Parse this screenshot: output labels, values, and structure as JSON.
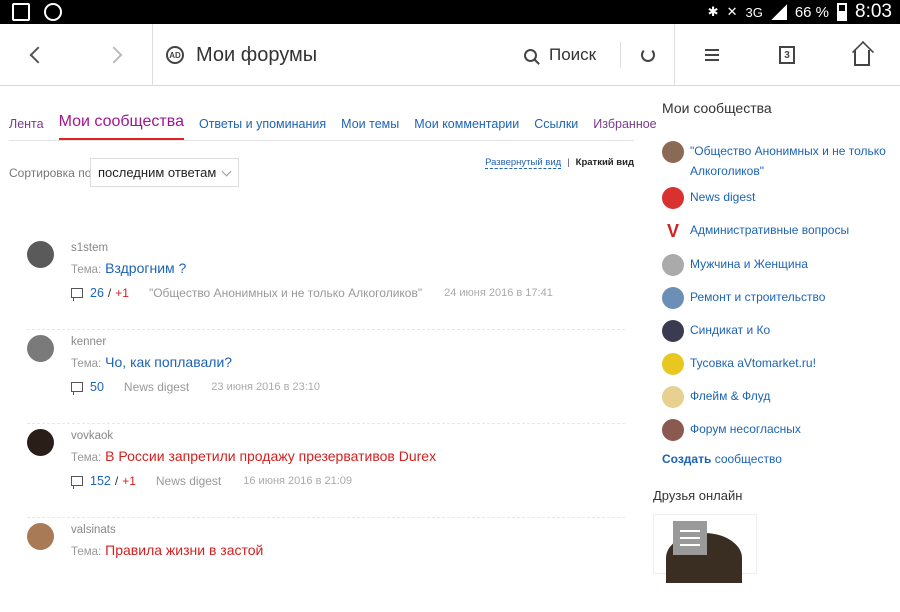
{
  "statusbar": {
    "network": "3G",
    "battery": "66 %",
    "time": "8:03"
  },
  "topbar": {
    "title": "Мои форумы",
    "search_label": "Поиск",
    "logo_text": "AD",
    "tabs_count": "3"
  },
  "nav": {
    "items": [
      {
        "label": "Лента"
      },
      {
        "label": "Мои сообщества"
      },
      {
        "label": "Ответы и упоминания"
      },
      {
        "label": "Мои темы"
      },
      {
        "label": "Мои комментарии"
      },
      {
        "label": "Ссылки"
      },
      {
        "label": "Избранное"
      }
    ],
    "active_index": 1
  },
  "sort": {
    "label": "Сортировка по",
    "value": "последним ответам"
  },
  "view": {
    "expanded": "Развернутый вид",
    "separator": "|",
    "compact": "Краткий вид"
  },
  "posts": [
    {
      "user": "s1stem",
      "topic_prefix": "Тема:",
      "topic": "Вздрогним ?",
      "topic_color": "blue",
      "count": "26",
      "plus": "+1",
      "forum": "\"Общество Анонимных и не только Алкоголиков\"",
      "date": "24 июня 2016 в 17:41",
      "avatar_color": "#5a5a5a"
    },
    {
      "user": "kenner",
      "topic_prefix": "Тема:",
      "topic": "Чо, как поплавали?",
      "topic_color": "blue",
      "count": "50",
      "plus": "",
      "forum": "News digest",
      "date": "23 июня 2016 в 23:10",
      "avatar_color": "#7a7a7a"
    },
    {
      "user": "vovkaok",
      "topic_prefix": "Тема:",
      "topic": "В России запретили продажу презервативов Durex",
      "topic_color": "red",
      "count": "152",
      "plus": "+1",
      "forum": "News digest",
      "date": "16 июня 2016 в 21:09",
      "avatar_color": "#2a1f18"
    },
    {
      "user": "valsinats",
      "topic_prefix": "Тема:",
      "topic": "Правила жизни в застой",
      "topic_color": "red",
      "count": "",
      "plus": "",
      "forum": "",
      "date": "",
      "avatar_color": "#a87a55"
    }
  ],
  "sidebar": {
    "title": "Мои сообщества",
    "communities": [
      {
        "name": "\"Общество Анонимных и не только Алкоголиков\"",
        "color": "#8a6a55"
      },
      {
        "name": "News digest",
        "color": "#d93030"
      },
      {
        "name": "Административные вопросы",
        "color": "#d42020"
      },
      {
        "name": "Мужчина и Женщина",
        "color": "#aaaaaa"
      },
      {
        "name": "Ремонт и строительство",
        "color": "#6b8fb5"
      },
      {
        "name": "Синдикат и Ко",
        "color": "#3a3a50"
      },
      {
        "name": "Тусовка aVtomarket.ru!",
        "color": "#e8c820"
      },
      {
        "name": "Флейм & Флуд",
        "color": "#e8d090"
      },
      {
        "name": "Форум несогласных",
        "color": "#8a5a50"
      }
    ],
    "create_bold": "Создать",
    "create_rest": " сообщество",
    "friends_title": "Друзья онлайн"
  }
}
